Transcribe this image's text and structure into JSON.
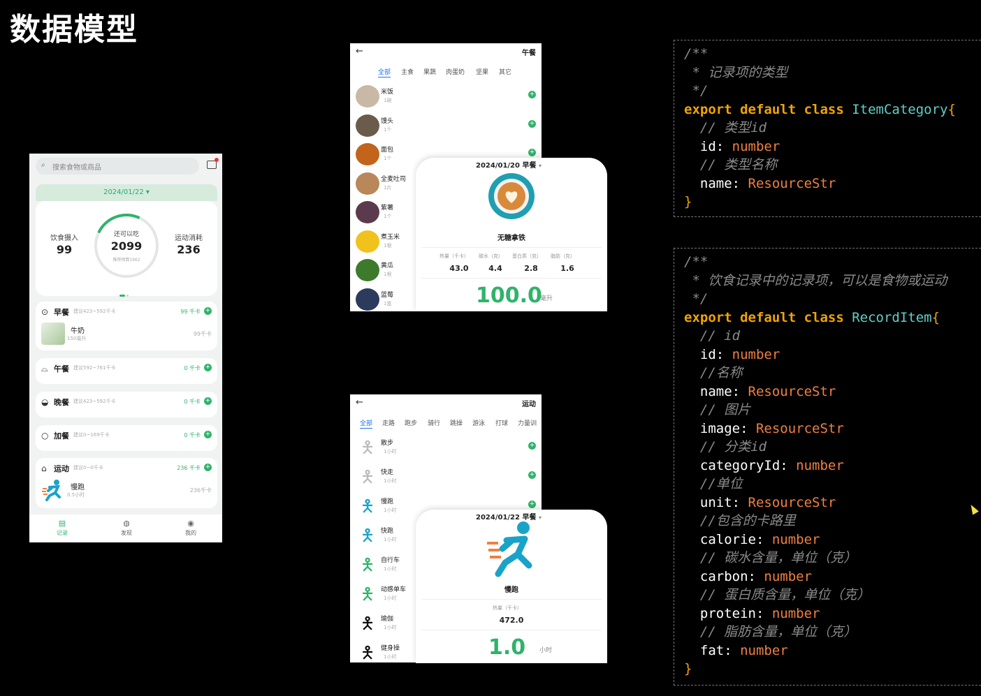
{
  "title": "数据模型",
  "phone1": {
    "search_placeholder": "搜索食物或商品",
    "date": "2024/01/22 ▾",
    "stats": {
      "intake_label": "饮食摄入",
      "intake_value": "99",
      "remain_label": "还可以吃",
      "remain_value": "2099",
      "remain_sub": "推荐预算1962",
      "burn_label": "运动消耗",
      "burn_value": "236"
    },
    "meals": [
      {
        "icon": "⊙",
        "name": "早餐",
        "suggest": "建议423~592千卡",
        "kcal": "99 千卡",
        "item": {
          "name": "牛奶",
          "amount": "150毫升",
          "kcal": "99千卡"
        }
      },
      {
        "icon": "⌓",
        "name": "午餐",
        "suggest": "建议592~761千卡",
        "kcal": "0 千卡"
      },
      {
        "icon": "◒",
        "name": "晚餐",
        "suggest": "建议423~592千卡",
        "kcal": "0 千卡"
      },
      {
        "icon": "○",
        "name": "加餐",
        "suggest": "建议0~169千卡",
        "kcal": "0 千卡"
      },
      {
        "icon": "⌂",
        "name": "运动",
        "suggest": "建议0~0千卡",
        "kcal": "236 千卡",
        "item": {
          "name": "慢跑",
          "amount": "0.5小时",
          "kcal": "236千卡"
        }
      }
    ],
    "tabs": [
      "记录",
      "发现",
      "我的"
    ]
  },
  "screen_food": {
    "title": "午餐",
    "categories": [
      "全部",
      "主食",
      "果蔬",
      "肉蛋奶",
      "坚果",
      "其它"
    ],
    "items": [
      {
        "name": "米饭",
        "amount": "1碗",
        "color": "#c9b8a6"
      },
      {
        "name": "馒头",
        "amount": "1个",
        "color": "#6b5b4b"
      },
      {
        "name": "面包",
        "amount": "1个",
        "color": "#c2641c"
      },
      {
        "name": "全麦吐司",
        "amount": "1片",
        "color": "#b8875a"
      },
      {
        "name": "紫薯",
        "amount": "1个",
        "color": "#5c3a4e"
      },
      {
        "name": "煮玉米",
        "amount": "1根",
        "color": "#f2c21c"
      },
      {
        "name": "黄瓜",
        "amount": "1根",
        "color": "#3d7a2c"
      },
      {
        "name": "蓝莓",
        "amount": "1盒",
        "color": "#2c3a5e"
      }
    ],
    "popup": {
      "date": "2024/01/20 早餐",
      "name": "无糖拿铁",
      "nutrients": [
        {
          "label": "热量（千卡）",
          "value": "43.0"
        },
        {
          "label": "碳水（克）",
          "value": "4.4"
        },
        {
          "label": "蛋白质（克）",
          "value": "2.8"
        },
        {
          "label": "脂肪（克）",
          "value": "1.6"
        }
      ],
      "amount": "100.0",
      "unit": "毫升"
    }
  },
  "screen_sport": {
    "title": "运动",
    "categories": [
      "全部",
      "走路",
      "跑步",
      "骑行",
      "跳操",
      "游泳",
      "打球",
      "力量训"
    ],
    "items": [
      {
        "name": "散步",
        "amount": "1小时",
        "color": "#bbbbbb"
      },
      {
        "name": "快走",
        "amount": "1小时",
        "color": "#bbbbbb"
      },
      {
        "name": "慢跑",
        "amount": "1小时",
        "color": "#1aa3c8"
      },
      {
        "name": "快跑",
        "amount": "1小时",
        "color": "#1aa3c8"
      },
      {
        "name": "自行车",
        "amount": "1小时",
        "color": "#2fb36b"
      },
      {
        "name": "动感单车",
        "amount": "1小时",
        "color": "#2fb36b"
      },
      {
        "name": "瑜伽",
        "amount": "1小时",
        "color": "#111111"
      },
      {
        "name": "健身操",
        "amount": "1小时",
        "color": "#111111"
      }
    ],
    "popup": {
      "date": "2024/01/22 早餐",
      "name": "慢跑",
      "kcal_label": "热量（千卡）",
      "kcal_value": "472.0",
      "amount": "1.0",
      "unit": "小时"
    }
  },
  "code1": {
    "c1": "/**",
    "c2": " * 记录项的类型",
    "c3": " */",
    "kw": "export default class ",
    "cls": "ItemCategory",
    "f1c": "  // 类型id",
    "f1": "  id: ",
    "f1t": "number",
    "f2c": "  // 类型名称",
    "f2": "  name: ",
    "f2t": "ResourceStr"
  },
  "code2": {
    "c1": "/**",
    "c2": " * 饮食记录中的记录项，可以是食物或运动",
    "c3": " */",
    "kw": "export default class ",
    "cls": "RecordItem",
    "fields": [
      {
        "c": "  // id",
        "n": "  id: ",
        "t": "number"
      },
      {
        "c": "  //名称",
        "n": "  name: ",
        "t": "ResourceStr"
      },
      {
        "c": "  // 图片",
        "n": "  image: ",
        "t": "ResourceStr"
      },
      {
        "c": "  // 分类id",
        "n": "  categoryId: ",
        "t": "number"
      },
      {
        "c": "  //单位",
        "n": "  unit: ",
        "t": "ResourceStr"
      },
      {
        "c": "  //包含的卡路里",
        "n": "  calorie: ",
        "t": "number"
      },
      {
        "c": "  // 碳水含量，单位（克）",
        "n": "  carbon: ",
        "t": "number"
      },
      {
        "c": "  // 蛋白质含量，单位（克）",
        "n": "  protein: ",
        "t": "number"
      },
      {
        "c": "  // 脂肪含量，单位（克）",
        "n": "  fat: ",
        "t": "number"
      }
    ]
  },
  "colors": {
    "accent": "#2fb36b",
    "link": "#1a73e8",
    "keyword": "#f0a500",
    "class": "#5fd0c8",
    "type": "#f08040"
  }
}
